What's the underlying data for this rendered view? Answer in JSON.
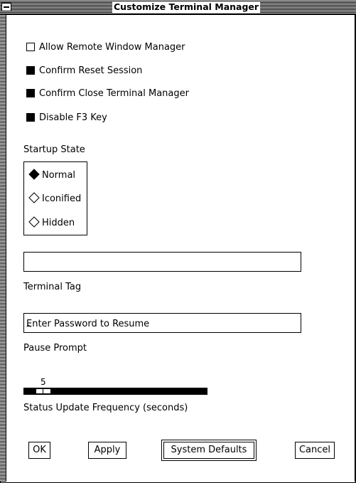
{
  "window": {
    "title": "Customize Terminal Manager"
  },
  "options": [
    {
      "label": "Allow Remote Window Manager",
      "checked": false
    },
    {
      "label": "Confirm Reset Session",
      "checked": true
    },
    {
      "label": "Confirm Close Terminal Manager",
      "checked": true
    },
    {
      "label": "Disable F3 Key",
      "checked": true
    }
  ],
  "startup": {
    "label": "Startup State",
    "options": [
      "Normal",
      "Iconified",
      "Hidden"
    ],
    "selected": "Normal"
  },
  "terminal_tag": {
    "value": "",
    "label": "Terminal Tag"
  },
  "pause_prompt": {
    "value": "Enter Password to Resume",
    "label": "Pause Prompt"
  },
  "status_update": {
    "value": "5",
    "label": "Status Update Frequency (seconds)"
  },
  "buttons": {
    "ok": "OK",
    "apply": "Apply",
    "defaults": "System Defaults",
    "cancel": "Cancel"
  }
}
